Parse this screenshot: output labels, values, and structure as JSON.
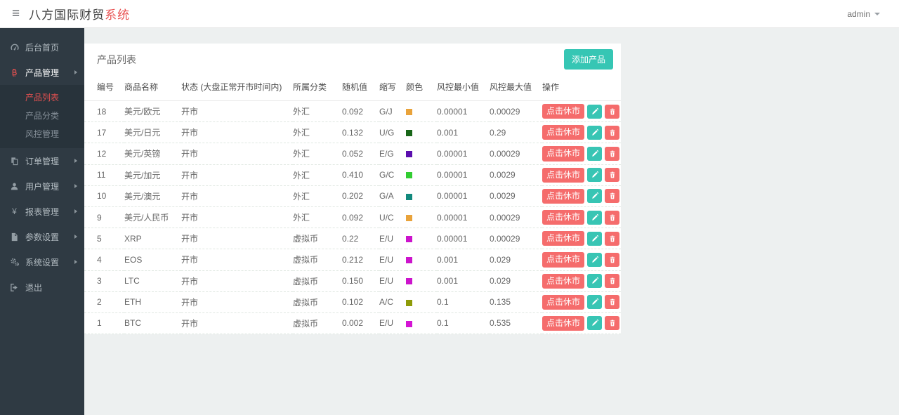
{
  "header": {
    "title": "八方国际财贸",
    "title_accent": "系统",
    "user_menu": "admin"
  },
  "sidebar": {
    "items": [
      {
        "label": "后台首页",
        "icon": "dashboard-icon"
      },
      {
        "label": "产品管理",
        "icon": "bitcoin-icon"
      },
      {
        "label": "订单管理",
        "icon": "orders-icon"
      },
      {
        "label": "用户管理",
        "icon": "users-icon"
      },
      {
        "label": "报表管理",
        "icon": "yen-icon"
      },
      {
        "label": "参数设置",
        "icon": "params-icon"
      },
      {
        "label": "系统设置",
        "icon": "gear-icon"
      },
      {
        "label": "退出",
        "icon": "logout-icon"
      }
    ],
    "product_submenu": [
      {
        "label": "产品列表",
        "active": true
      },
      {
        "label": "产品分类",
        "active": false
      },
      {
        "label": "风控管理",
        "active": false
      }
    ]
  },
  "main": {
    "card_title": "产品列表",
    "add_product_button": "添加产品",
    "table": {
      "headers": [
        "编号",
        "商品名称",
        "状态 (大盘正常开市时间内)",
        "所属分类",
        "随机值",
        "缩写",
        "颜色",
        "风控最小值",
        "风控最大值",
        "操作"
      ],
      "rows": [
        {
          "id": "18",
          "name": "美元/欧元",
          "status": "开市",
          "category": "外汇",
          "random_value": "0.092",
          "abbr": "G/J",
          "color": "#E9A33B",
          "risk_min": "0.00001",
          "risk_max": "0.00029"
        },
        {
          "id": "17",
          "name": "美元/日元",
          "status": "开市",
          "category": "外汇",
          "random_value": "0.132",
          "abbr": "U/G",
          "color": "#186618",
          "risk_min": "0.001",
          "risk_max": "0.29"
        },
        {
          "id": "12",
          "name": "美元/英镑",
          "status": "开市",
          "category": "外汇",
          "random_value": "0.052",
          "abbr": "E/G",
          "color": "#5B0EAE",
          "risk_min": "0.00001",
          "risk_max": "0.00029"
        },
        {
          "id": "11",
          "name": "美元/加元",
          "status": "开市",
          "category": "外汇",
          "random_value": "0.410",
          "abbr": "G/C",
          "color": "#32CD32",
          "risk_min": "0.00001",
          "risk_max": "0.0029"
        },
        {
          "id": "10",
          "name": "美元/澳元",
          "status": "开市",
          "category": "外汇",
          "random_value": "0.202",
          "abbr": "G/A",
          "color": "#12897D",
          "risk_min": "0.00001",
          "risk_max": "0.0029"
        },
        {
          "id": "9",
          "name": "美元/人民币",
          "status": "开市",
          "category": "外汇",
          "random_value": "0.092",
          "abbr": "U/C",
          "color": "#E9A33B",
          "risk_min": "0.00001",
          "risk_max": "0.00029"
        },
        {
          "id": "5",
          "name": "XRP",
          "status": "开市",
          "category": "虚拟币",
          "random_value": "0.22",
          "abbr": "E/U",
          "color": "#CC14CC",
          "risk_min": "0.00001",
          "risk_max": "0.00029"
        },
        {
          "id": "4",
          "name": "EOS",
          "status": "开市",
          "category": "虚拟币",
          "random_value": "0.212",
          "abbr": "E/U",
          "color": "#CC14CC",
          "risk_min": "0.001",
          "risk_max": "0.029"
        },
        {
          "id": "3",
          "name": "LTC",
          "status": "开市",
          "category": "虚拟币",
          "random_value": "0.150",
          "abbr": "E/U",
          "color": "#CC14CC",
          "risk_min": "0.001",
          "risk_max": "0.029"
        },
        {
          "id": "2",
          "name": "ETH",
          "status": "开市",
          "category": "虚拟币",
          "random_value": "0.102",
          "abbr": "A/C",
          "color": "#8E9B08",
          "risk_min": "0.1",
          "risk_max": "0.135"
        },
        {
          "id": "1",
          "name": "BTC",
          "status": "开市",
          "category": "虚拟币",
          "random_value": "0.002",
          "abbr": "E/U",
          "color": "#D414D4",
          "risk_min": "0.1",
          "risk_max": "0.535"
        }
      ],
      "row_actions": {
        "close_market_label": "点击休市",
        "edit_icon": "pencil-icon",
        "delete_icon": "trash-icon"
      }
    }
  },
  "colors": {
    "accent_teal": "#36C6B4",
    "accent_red": "#F56C6C",
    "sidebar_bg": "#2F3A43",
    "active_text_red": "#E25050"
  }
}
